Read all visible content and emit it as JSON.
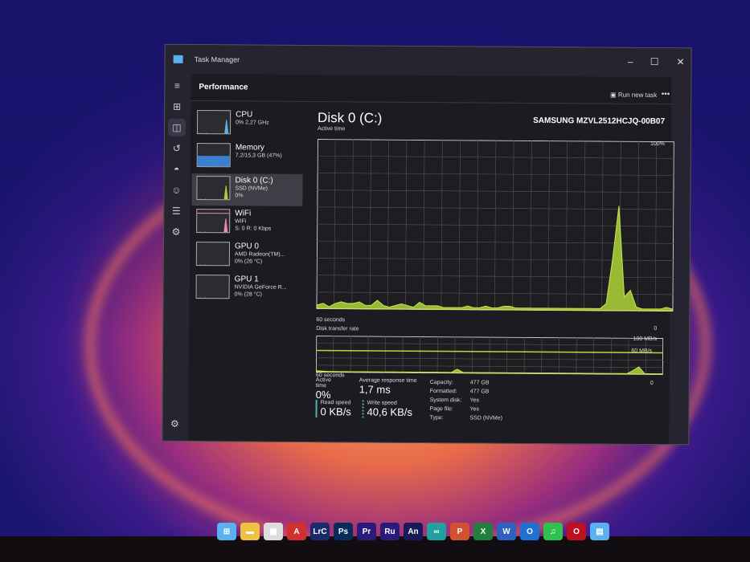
{
  "window": {
    "title": "Task Manager",
    "minimize": "–",
    "maximize": "☐",
    "close": "✕"
  },
  "rail": [
    "menu-icon",
    "processes-icon",
    "performance-icon",
    "history-icon",
    "startup-icon",
    "users-icon",
    "details-icon",
    "services-icon",
    "settings-icon"
  ],
  "header": {
    "title": "Performance",
    "run_new_task": "Run new task",
    "more": "•••"
  },
  "devices": [
    {
      "name": "CPU",
      "l1": "0% 2,27 GHz",
      "l2": "",
      "color": "#5ab4e8"
    },
    {
      "name": "Memory",
      "l1": "7,2/15,3 GB (47%)",
      "l2": "",
      "color": "#3a7fd0"
    },
    {
      "name": "Disk 0 (C:)",
      "l1": "SSD (NVMe)",
      "l2": "0%",
      "color": "#a8d040"
    },
    {
      "name": "WiFi",
      "l1": "WiFi",
      "l2": "S: 0 R: 0 Kbps",
      "color": "#e889b0"
    },
    {
      "name": "GPU 0",
      "l1": "AMD Radeon(TM)...",
      "l2": "0% (26 °C)",
      "color": "#c080e0"
    },
    {
      "name": "GPU 1",
      "l1": "NVIDIA GeForce R...",
      "l2": "0% (28 °C)",
      "color": "#c080e0"
    }
  ],
  "detail": {
    "title": "Disk 0 (C:)",
    "model": "SAMSUNG MZVL2512HCJQ-00B07"
  },
  "chart_data": [
    {
      "type": "area",
      "title": "Active time",
      "xlabel": "60 seconds",
      "ymax_label": "100%",
      "ymin_label": "0",
      "ylim": [
        0,
        100
      ],
      "values": [
        2,
        3,
        1,
        3,
        4,
        3,
        3,
        4,
        2,
        2,
        5,
        2,
        1,
        2,
        3,
        2,
        1,
        4,
        2,
        2,
        2,
        1,
        1,
        1,
        1,
        2,
        1,
        1,
        2,
        1,
        1,
        2,
        2,
        1,
        1,
        1,
        1,
        1,
        1,
        1,
        1,
        1,
        1,
        1,
        1,
        1,
        1,
        1,
        4,
        30,
        62,
        8,
        12,
        2,
        1,
        1,
        1,
        1,
        2,
        1
      ]
    },
    {
      "type": "area",
      "title": "Disk transfer rate",
      "xlabel": "60 seconds",
      "ymax_label": "100 MB/s",
      "mid_label": "60 MB/s",
      "ymin_label": "0",
      "ylim": [
        0,
        100
      ],
      "values": [
        3,
        2,
        1,
        1,
        1,
        1,
        1,
        1,
        1,
        1,
        1,
        1,
        1,
        1,
        1,
        1,
        1,
        1,
        1,
        1,
        1,
        1,
        1,
        1,
        10,
        1,
        1,
        1,
        1,
        1,
        1,
        1,
        1,
        1,
        1,
        1,
        1,
        1,
        1,
        1,
        1,
        1,
        1,
        1,
        1,
        1,
        1,
        1,
        1,
        1,
        1,
        1,
        1,
        1,
        10,
        20,
        1,
        1,
        1,
        1
      ]
    }
  ],
  "stats": {
    "active_label": "Active time",
    "active": "0%",
    "resp_label": "Average response time",
    "resp": "1,7 ms",
    "read_label": "Read speed",
    "read": "0 KB/s",
    "write_label": "Write speed",
    "write": "40,6 KB/s",
    "props": [
      [
        "Capacity:",
        "477 GB"
      ],
      [
        "Formatted:",
        "477 GB"
      ],
      [
        "System disk:",
        "Yes"
      ],
      [
        "Page file:",
        "Yes"
      ],
      [
        "Type:",
        "SSD (NVMe)"
      ]
    ]
  },
  "taskbar": [
    [
      "start",
      "⊞",
      "#5ab0f0"
    ],
    [
      "explorer",
      "▬",
      "#f0c040"
    ],
    [
      "store",
      "▦",
      "#ddd"
    ],
    [
      "acrobat",
      "A",
      "#d03030"
    ],
    [
      "lightroom",
      "LrC",
      "#1a2a6a"
    ],
    [
      "photoshop",
      "Ps",
      "#0a2a5a"
    ],
    [
      "premiere",
      "Pr",
      "#2a1a7a"
    ],
    [
      "rush",
      "Ru",
      "#2a1a7a"
    ],
    [
      "animate",
      "An",
      "#1a1a5a"
    ],
    [
      "arduino",
      "∞",
      "#20a0a0"
    ],
    [
      "powerpoint",
      "P",
      "#d05030"
    ],
    [
      "excel",
      "X",
      "#208040"
    ],
    [
      "word",
      "W",
      "#3060c0"
    ],
    [
      "outlook",
      "O",
      "#2070d0"
    ],
    [
      "spotify",
      "♫",
      "#30c050"
    ],
    [
      "opera",
      "O",
      "#c01020"
    ],
    [
      "taskmanager",
      "▤",
      "#5ab0f0"
    ]
  ]
}
